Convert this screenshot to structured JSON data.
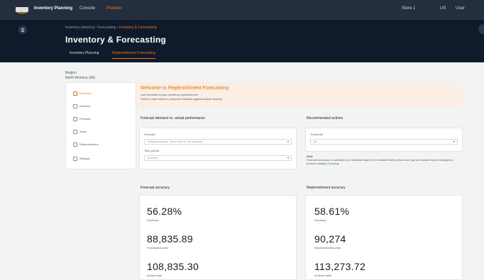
{
  "topbar": {
    "app_name": "Inventory Planning",
    "tenant": "Console",
    "tag": "Preview",
    "account": "Store 1",
    "region": "US",
    "user": "User"
  },
  "breadcrumb": {
    "items": [
      "Inventory planning",
      "Forecasting",
      "Inventory & Forecasting"
    ]
  },
  "page": {
    "title": "Inventory & Forecasting",
    "info": "Info"
  },
  "tabs": [
    {
      "label": "Inventory Planning"
    },
    {
      "label": "Replenishment Forecasting"
    }
  ],
  "region_label": {
    "line1": "Region",
    "line2": "North America (All)"
  },
  "sidebar": {
    "items": [
      {
        "label": "Overview"
      },
      {
        "label": "Demand"
      },
      {
        "label": "Forecast"
      },
      {
        "label": "Stock"
      },
      {
        "label": "Replenishment"
      },
      {
        "label": "Settings"
      }
    ]
  },
  "promo": {
    "title": "Welcome to Replenishment Forecasting",
    "line1": "Use forecasts to plan inventory replenishment",
    "line2": "Select a view below to compare forecasts against actual demand"
  },
  "left_panel": {
    "title": "Forecast demand vs. actual performance",
    "field1_label": "Forecast",
    "field1_value": "Weekly forecast - Most recent - All products",
    "field2_label": "Time period",
    "field2_value": "8 weeks"
  },
  "right_panel": {
    "title": "Recommended actions",
    "field_label": "Threshold",
    "field_value": "All",
    "note_label": "Note",
    "note_text": "Forecast accuracy is calculated on historical data for the selected time period and may not include recent changes to product catalog or pricing."
  },
  "kpi_left": {
    "title": "Forecast accuracy",
    "items": [
      {
        "value": "56.28%",
        "label": "Accuracy"
      },
      {
        "value": "88,835.89",
        "label": "Forecasted units"
      },
      {
        "value": "108,835.30",
        "label": "Actual units"
      }
    ]
  },
  "kpi_right": {
    "title": "Replenishment accuracy",
    "items": [
      {
        "value": "58.61%",
        "label": "Accuracy"
      },
      {
        "value": "90,274",
        "label": "Recommended units"
      },
      {
        "value": "113,273.72",
        "label": "Ordered units"
      }
    ]
  },
  "colors": {
    "accent": "#ec7211",
    "topbar": "#232f3e",
    "header": "#0f1b2a"
  }
}
